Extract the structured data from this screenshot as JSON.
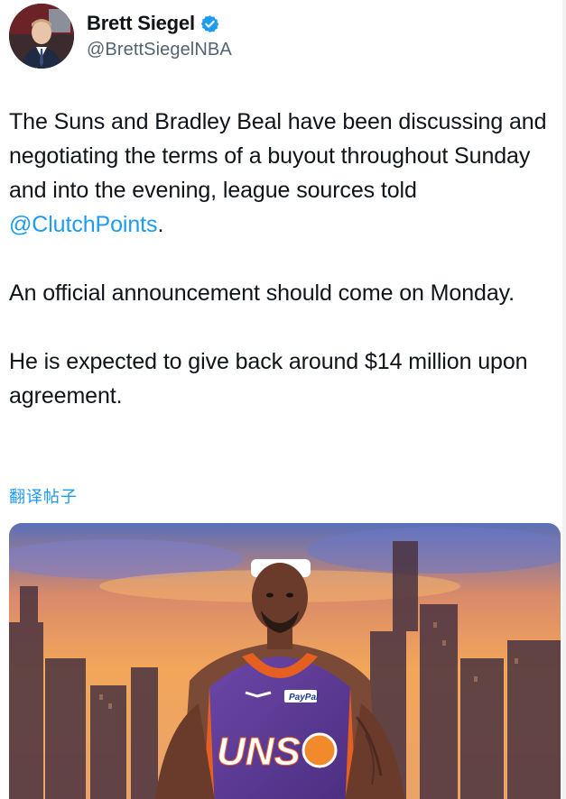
{
  "author": {
    "display_name": "Brett Siegel",
    "handle": "@BrettSiegelNBA",
    "verified_icon": "verified-badge-icon",
    "avatar_icon": "profile-photo"
  },
  "tweet": {
    "p1_text": "The Suns and Bradley Beal have been discussing and negotiating the terms of a buyout throughout Sunday and into the evening, league sources told ",
    "p1_mention": "@ClutchPoints",
    "p1_end": ".",
    "p2": "An official announcement should come on Monday.",
    "p3": "He is expected to give back around $14 million upon agreement."
  },
  "translate_label": "翻译帖子",
  "media": {
    "description_icon": "player-photo-city-skyline",
    "jersey_text": "UNS",
    "sponsor_text": "PayPal"
  },
  "colors": {
    "link": "#1d9bf0",
    "text": "#0f1419",
    "secondary": "#536471",
    "jersey_purple": "#5a3a8c",
    "jersey_orange": "#e56020"
  }
}
